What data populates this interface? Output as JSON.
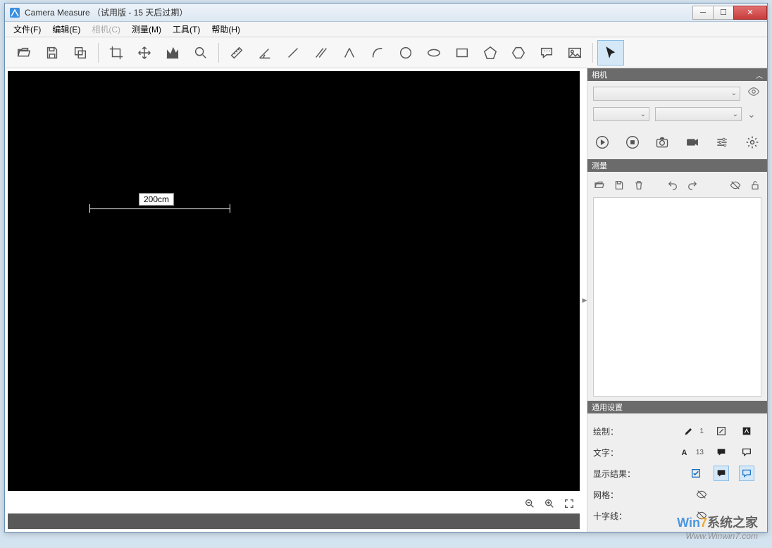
{
  "window": {
    "title": "Camera Measure （试用版 - 15 天后过期）"
  },
  "menu": {
    "file": "文件(F)",
    "edit": "编辑(E)",
    "camera": "相机(C)",
    "measure": "测量(M)",
    "tools": "工具(T)",
    "help": "帮助(H)"
  },
  "canvas": {
    "measurement_label": "200cm"
  },
  "sidepanel": {
    "camera": {
      "title": "相机"
    },
    "measure": {
      "title": "测量"
    },
    "settings": {
      "title": "通用设置",
      "draw": "绘制：",
      "draw_size": "1",
      "text": "文字：",
      "text_size": "13",
      "show_result": "显示结果：",
      "grid": "网格：",
      "crosshair": "十字线："
    }
  },
  "watermark": {
    "brand_win": "Win",
    "brand_7": "7",
    "brand_rest": "系统之家",
    "url": "Www.Winwin7.com"
  }
}
